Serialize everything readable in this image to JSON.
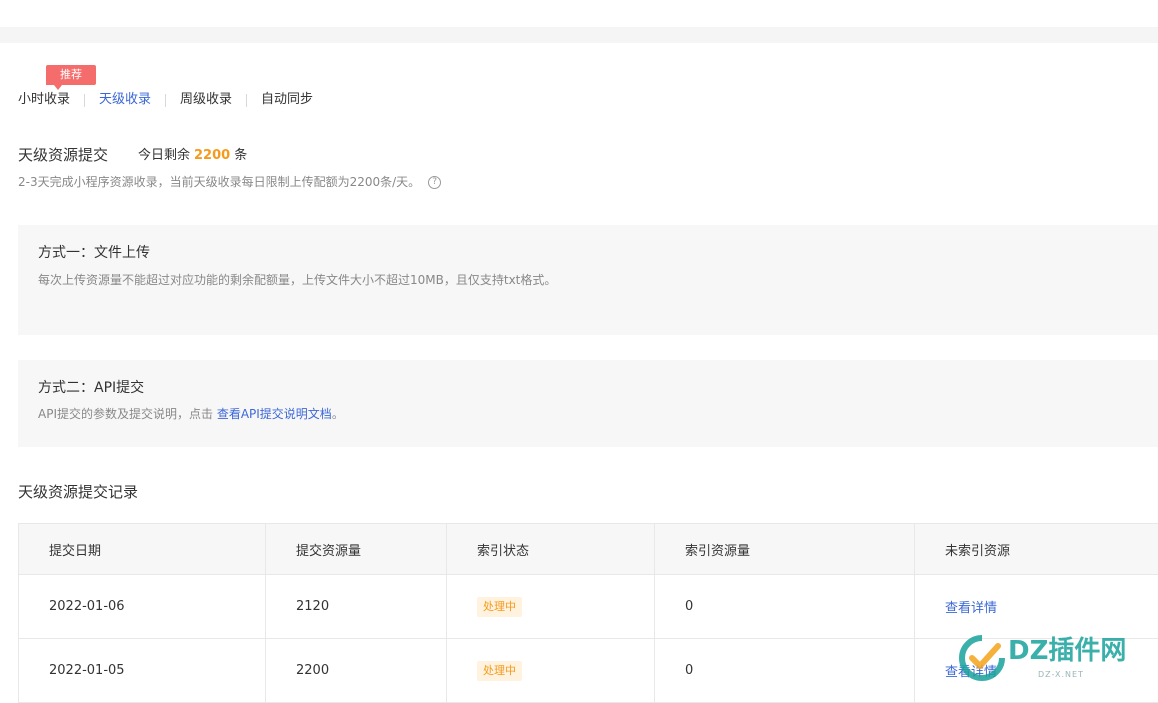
{
  "tabs": {
    "badge": "推荐",
    "items": [
      {
        "label": "小时收录"
      },
      {
        "label": "天级收录"
      },
      {
        "label": "周级收录"
      },
      {
        "label": "自动同步"
      }
    ]
  },
  "submit": {
    "title": "天级资源提交",
    "quota_prefix": "今日剩余",
    "quota_value": "2200",
    "quota_suffix": "条",
    "description": "2-3天完成小程序资源收录，当前天级收录每日限制上传配额为2200条/天。"
  },
  "method1": {
    "title": "方式一：文件上传",
    "text": "每次上传资源量不能超过对应功能的剩余配额量，上传文件大小不超过10MB，且仅支持txt格式。"
  },
  "method2": {
    "title": "方式二：API提交",
    "text": "API提交的参数及提交说明，点击 ",
    "link": "查看API提交说明文档",
    "text_end": "。"
  },
  "records": {
    "title": "天级资源提交记录",
    "columns": [
      "提交日期",
      "提交资源量",
      "索引状态",
      "索引资源量",
      "未索引资源"
    ],
    "rows": [
      {
        "date": "2022-01-06",
        "amount": "2120",
        "status": "处理中",
        "indexed": "0",
        "action": "查看详情"
      },
      {
        "date": "2022-01-05",
        "amount": "2200",
        "status": "处理中",
        "indexed": "0",
        "action": "查看详情"
      }
    ]
  },
  "watermark": {
    "text": "DZ插件网",
    "sub": "DZ-X.NET"
  },
  "colors": {
    "accent": "#3c68d6",
    "quota": "#f59a1b",
    "badge": "#f56c6c",
    "status_bg": "#fff3e0"
  }
}
